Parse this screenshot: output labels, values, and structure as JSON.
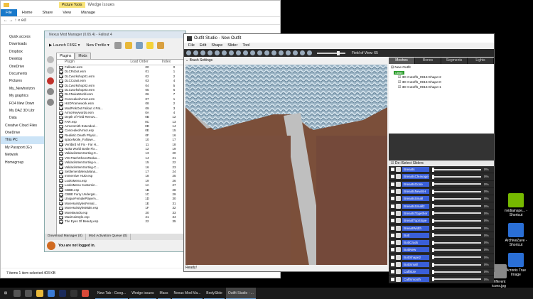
{
  "desktop_icons": [
    {
      "label": "nvidiainspe... - Shortcut",
      "color": "#76b900"
    },
    {
      "label": "ArchiveZave - Shortcut",
      "color": "#2a6fd6"
    },
    {
      "label": "Acronis True Image",
      "color": "#2a6fd6"
    },
    {
      "label": "Different icons.jpg",
      "color": "#888888"
    }
  ],
  "explorer": {
    "window_title_tab": "Picture Tools",
    "window_title": "Wedge issues",
    "ribbon": [
      "File",
      "Home",
      "Share",
      "View",
      "Manage"
    ],
    "address": "« ed",
    "nav": [
      "Quick access",
      "Downloads",
      "Dropbox",
      "Desktop",
      "OneDrive",
      "Documents",
      "Pictures",
      "My_Newhorizon",
      "My graphics",
      "FO4 New Down",
      "My DAZ 3D Libr",
      "Data",
      "Creative Cloud Files",
      "OneDrive",
      "This PC",
      "My Passport (G:)",
      "Network",
      "Homegroup"
    ],
    "selected_nav": "This PC",
    "status": "7 items    1 item selected  403 KB"
  },
  "nmm": {
    "title": "Nexus Mod Manager (0.65.4) - Fallout 4",
    "launch_label": "Launch F4SE",
    "profile_label": "New Profile",
    "tabs": [
      "Plugins",
      "Mods"
    ],
    "columns": [
      "Plugin",
      "Load Order",
      "Index"
    ],
    "plugins": [
      [
        "Fallout4.esm",
        "00",
        "0"
      ],
      [
        "DLCRobot.esm",
        "01",
        "1"
      ],
      [
        "DLCworkshop01.esm",
        "02",
        "2"
      ],
      [
        "DLCCoast.esm",
        "03",
        "4"
      ],
      [
        "DLCworkshop02.esm",
        "04",
        "5"
      ],
      [
        "DLCworkshop03.esm",
        "05",
        "6"
      ],
      [
        "DLCNukaWorld.esm",
        "06",
        "7"
      ],
      [
        "ConcealedArmor.esm",
        "07",
        "1"
      ],
      [
        "HUDFramework.esm",
        "08",
        "2"
      ],
      [
        "ModPinkOut Fallout 4 Pat...",
        "09",
        "3"
      ],
      [
        "ArmorKeywords.esm",
        "0A",
        "4"
      ],
      [
        "Depth of Field Remov...",
        "0B",
        "12"
      ],
      [
        "FAR.esp",
        "0C",
        "13"
      ],
      [
        "Armorsmith Extended...",
        "0D",
        "14"
      ],
      [
        "ConcealedArmor.esp",
        "0E",
        "15"
      ],
      [
        "Realistic Death Physic...",
        "0F",
        "16"
      ],
      [
        "spaceMoile_Followe...",
        "10",
        "17"
      ],
      [
        "Vertibird All Fix - Far H...",
        "11",
        "18"
      ],
      [
        "Nuka World Bottle Fix...",
        "12",
        "19"
      ],
      [
        "ValdacilsItemSorting-0...",
        "13",
        "20"
      ],
      [
        "VIS-PatchCheesRedux...",
        "14",
        "21"
      ],
      [
        "ValdacilsItemSorting-A...",
        "15",
        "22"
      ],
      [
        "ValdacilsItemSorting-C...",
        "16",
        "23"
      ],
      [
        "SettlementMenuMana...",
        "17",
        "24"
      ],
      [
        "Immersive HUD.esp",
        "18",
        "25"
      ],
      [
        "LooksMenu.esp",
        "19",
        "26"
      ],
      [
        "LooksMenu Customiz...",
        "1A",
        "27"
      ],
      [
        "CBBE.esp",
        "1B",
        "28"
      ],
      [
        "CBBE Furry Undergar...",
        "1C",
        "29"
      ],
      [
        "UniqueFemalePlayerA...",
        "1D",
        "30"
      ],
      [
        "MoreHairstylesFemal...",
        "1E",
        "31"
      ],
      [
        "MoreHairstylesMale.esp",
        "1F",
        "32"
      ],
      [
        "MoreBeards.esp",
        "20",
        "33"
      ],
      [
        "MaciHairstyle.esp",
        "21",
        "34"
      ],
      [
        "The Eyes Of Beauty.esp",
        "22",
        "35"
      ]
    ],
    "bottom_tabs": [
      "Download Manager (0)",
      "Mod Activation Queue (0)"
    ],
    "login_status": "You are not logged in."
  },
  "outfit_studio": {
    "title": "Outfit Studio - New Outfit",
    "menu": [
      "File",
      "Edit",
      "Shape",
      "Slider",
      "Tool"
    ],
    "fov_label": "Field of View: 65",
    "brush_settings": "Brush Settings",
    "status": "Ready!",
    "panel_tabs": [
      "Meshes",
      "Bones",
      "Segments",
      "Lights"
    ],
    "tree": {
      "root": "New Outfit",
      "badge": "CBBE",
      "shapes": [
        "3D Cutoffs_0916:Shape:2",
        "3D Cutoffs_0916:Shape:0",
        "3D Cutoffs_0916:Shape:1"
      ]
    },
    "sliders_header": "De-/Select Sliders",
    "sliders": [
      {
        "name": "Breasts",
        "value": "0%"
      },
      {
        "name": "BreastsCleavage",
        "value": "0%"
      },
      {
        "name": "BreastsGone",
        "value": "0%"
      },
      {
        "name": "BreastsNewSH",
        "value": "0%"
      },
      {
        "name": "BreastsSmall",
        "value": "0%"
      },
      {
        "name": "BreastsSmall2",
        "value": "0%"
      },
      {
        "name": "BreastsTogether",
        "value": "0%"
      },
      {
        "name": "BreastTopSlope",
        "value": "0%"
      },
      {
        "name": "BreastWidth",
        "value": "0%"
      },
      {
        "name": "Butt",
        "value": "0%"
      },
      {
        "name": "ButtCrack",
        "value": "0%"
      },
      {
        "name": "ButtNew",
        "value": "0%"
      },
      {
        "name": "ButtShape2",
        "value": "0%"
      },
      {
        "name": "ButtSmall",
        "value": "0%"
      },
      {
        "name": "CalfSize",
        "value": "0%"
      },
      {
        "name": "CalfSmooth",
        "value": "0%"
      }
    ]
  },
  "taskbar": [
    {
      "label": "New Tab - Goog...",
      "active": false
    },
    {
      "label": "Wedge issues",
      "active": false
    },
    {
      "label": "Macs",
      "active": false
    },
    {
      "label": "Nexus Mod Ma...",
      "active": false
    },
    {
      "label": "BodySlide",
      "active": false
    },
    {
      "label": "Outfit Studio - ...",
      "active": true
    }
  ]
}
